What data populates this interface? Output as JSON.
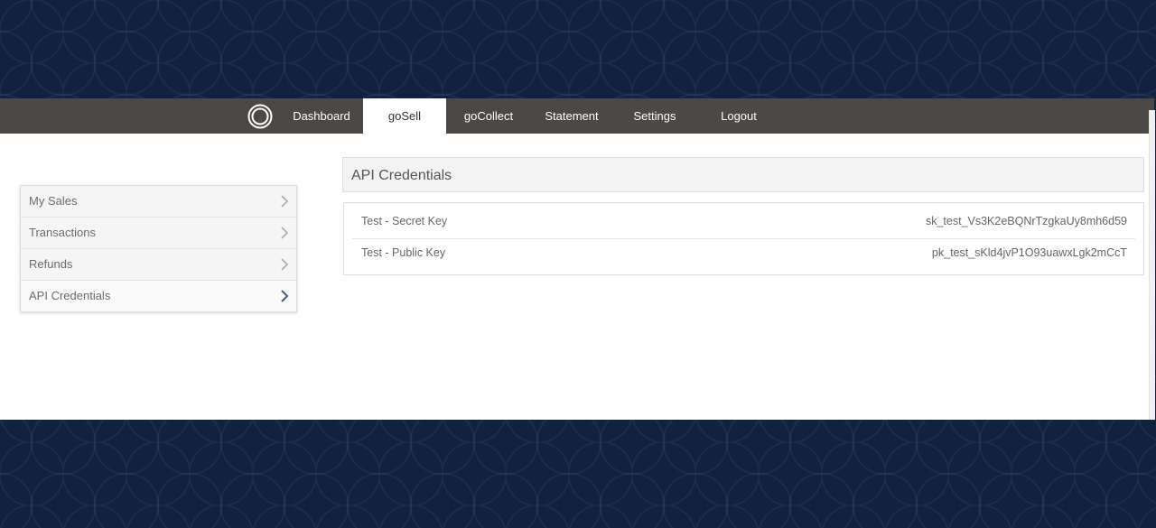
{
  "nav": {
    "logo_icon": "ring-logo-icon",
    "items": [
      {
        "label": "Dashboard"
      },
      {
        "label": "goSell"
      },
      {
        "label": "goCollect"
      },
      {
        "label": "Statement"
      },
      {
        "label": "Settings"
      },
      {
        "label": "Logout"
      }
    ],
    "active": "goSell"
  },
  "sidebar": {
    "items": [
      {
        "label": "My Sales"
      },
      {
        "label": "Transactions"
      },
      {
        "label": "Refunds"
      },
      {
        "label": "API Credentials"
      }
    ],
    "active": "API Credentials"
  },
  "panel": {
    "title": "API Credentials",
    "rows": [
      {
        "label": "Test - Secret Key",
        "value": "sk_test_Vs3K2eBQNrTzgkaUy8mh6d59"
      },
      {
        "label": "Test - Public Key",
        "value": "pk_test_sKld4jvP1O93uawxLgk2mCcT"
      }
    ]
  },
  "colors": {
    "background": "#10223f",
    "navbar": "#4c4845",
    "chevron": "#aaaaaa",
    "chevron_active": "#4a5a70"
  }
}
